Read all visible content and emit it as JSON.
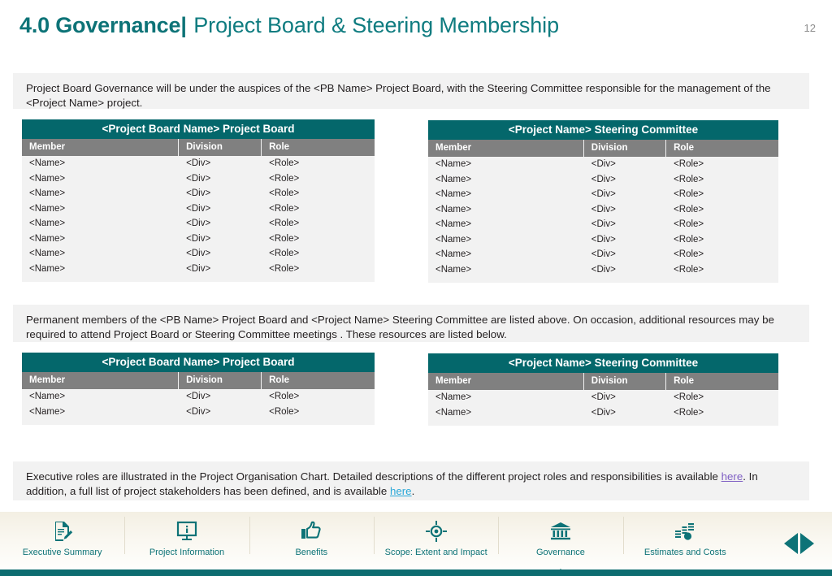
{
  "header": {
    "title_strong": "4.0 Governance",
    "title_pipe": "|",
    "title_rest": " Project Board & Steering Membership",
    "page_number": "12"
  },
  "paragraphs": {
    "intro": "Project Board Governance will be under the auspices of the <PB Name> Project Board, with the Steering Committee responsible for the management of the <Project Name> project.",
    "middle": "Permanent members of the <PB Name> Project Board and <Project Name> Steering Committee are listed above. On occasion, additional resources may be required to attend Project Board or Steering Committee meetings . These resources are listed below.",
    "footer_part1": "Executive roles are illustrated in the Project Organisation Chart. Detailed descriptions of the different project roles and responsibilities is available ",
    "footer_link1": "here",
    "footer_part2": ". In addition, a full list of project stakeholders has been defined, and is available ",
    "footer_link2": "here",
    "footer_part3": "."
  },
  "tables": {
    "columns": [
      "Member",
      "Division",
      "Role"
    ],
    "project_board_main": {
      "title": "<Project Board Name> Project Board",
      "rows": [
        [
          "<Name>",
          "<Div>",
          "<Role>"
        ],
        [
          "<Name>",
          "<Div>",
          "<Role>"
        ],
        [
          "<Name>",
          "<Div>",
          "<Role>"
        ],
        [
          "<Name>",
          "<Div>",
          "<Role>"
        ],
        [
          "<Name>",
          "<Div>",
          "<Role>"
        ],
        [
          "<Name>",
          "<Div>",
          "<Role>"
        ],
        [
          "<Name>",
          "<Div>",
          "<Role>"
        ],
        [
          "<Name>",
          "<Div>",
          "<Role>"
        ]
      ]
    },
    "steering_main": {
      "title": "<Project Name> Steering Committee",
      "rows": [
        [
          "<Name>",
          "<Div>",
          "<Role>"
        ],
        [
          "<Name>",
          "<Div>",
          "<Role>"
        ],
        [
          "<Name>",
          "<Div>",
          "<Role>"
        ],
        [
          "<Name>",
          "<Div>",
          "<Role>"
        ],
        [
          "<Name>",
          "<Div>",
          "<Role>"
        ],
        [
          "<Name>",
          "<Div>",
          "<Role>"
        ],
        [
          "<Name>",
          "<Div>",
          "<Role>"
        ],
        [
          "<Name>",
          "<Div>",
          "<Role>"
        ]
      ]
    },
    "project_board_extra": {
      "title": "<Project Board Name> Project Board",
      "rows": [
        [
          "<Name>",
          "<Div>",
          "<Role>"
        ],
        [
          "<Name>",
          "<Div>",
          "<Role>"
        ]
      ]
    },
    "steering_extra": {
      "title": "<Project Name> Steering Committee",
      "rows": [
        [
          "<Name>",
          "<Div>",
          "<Role>"
        ],
        [
          "<Name>",
          "<Div>",
          "<Role>"
        ]
      ]
    }
  },
  "navigation": {
    "items": [
      {
        "label": "Executive Summary",
        "icon": "document-pencil-icon",
        "active": false
      },
      {
        "label": "Project Information",
        "icon": "monitor-info-icon",
        "active": false
      },
      {
        "label": "Benefits",
        "icon": "thumbs-up-icon",
        "active": false
      },
      {
        "label": "Scope: Extent and Impact",
        "icon": "target-icon",
        "active": false
      },
      {
        "label": "Governance",
        "icon": "bank-building-icon",
        "active": true
      },
      {
        "label": "Estimates and Costs",
        "icon": "bar-chart-dot-icon",
        "active": false
      }
    ],
    "prev_label": "Previous slide",
    "next_label": "Next slide"
  },
  "colors": {
    "teal": "#0d7377",
    "teal_dark": "#04676b",
    "header_gray": "#808080",
    "panel_gray": "#f2f2f2",
    "link_purple": "#7f5fc4",
    "link_blue": "#2aa8d8"
  }
}
